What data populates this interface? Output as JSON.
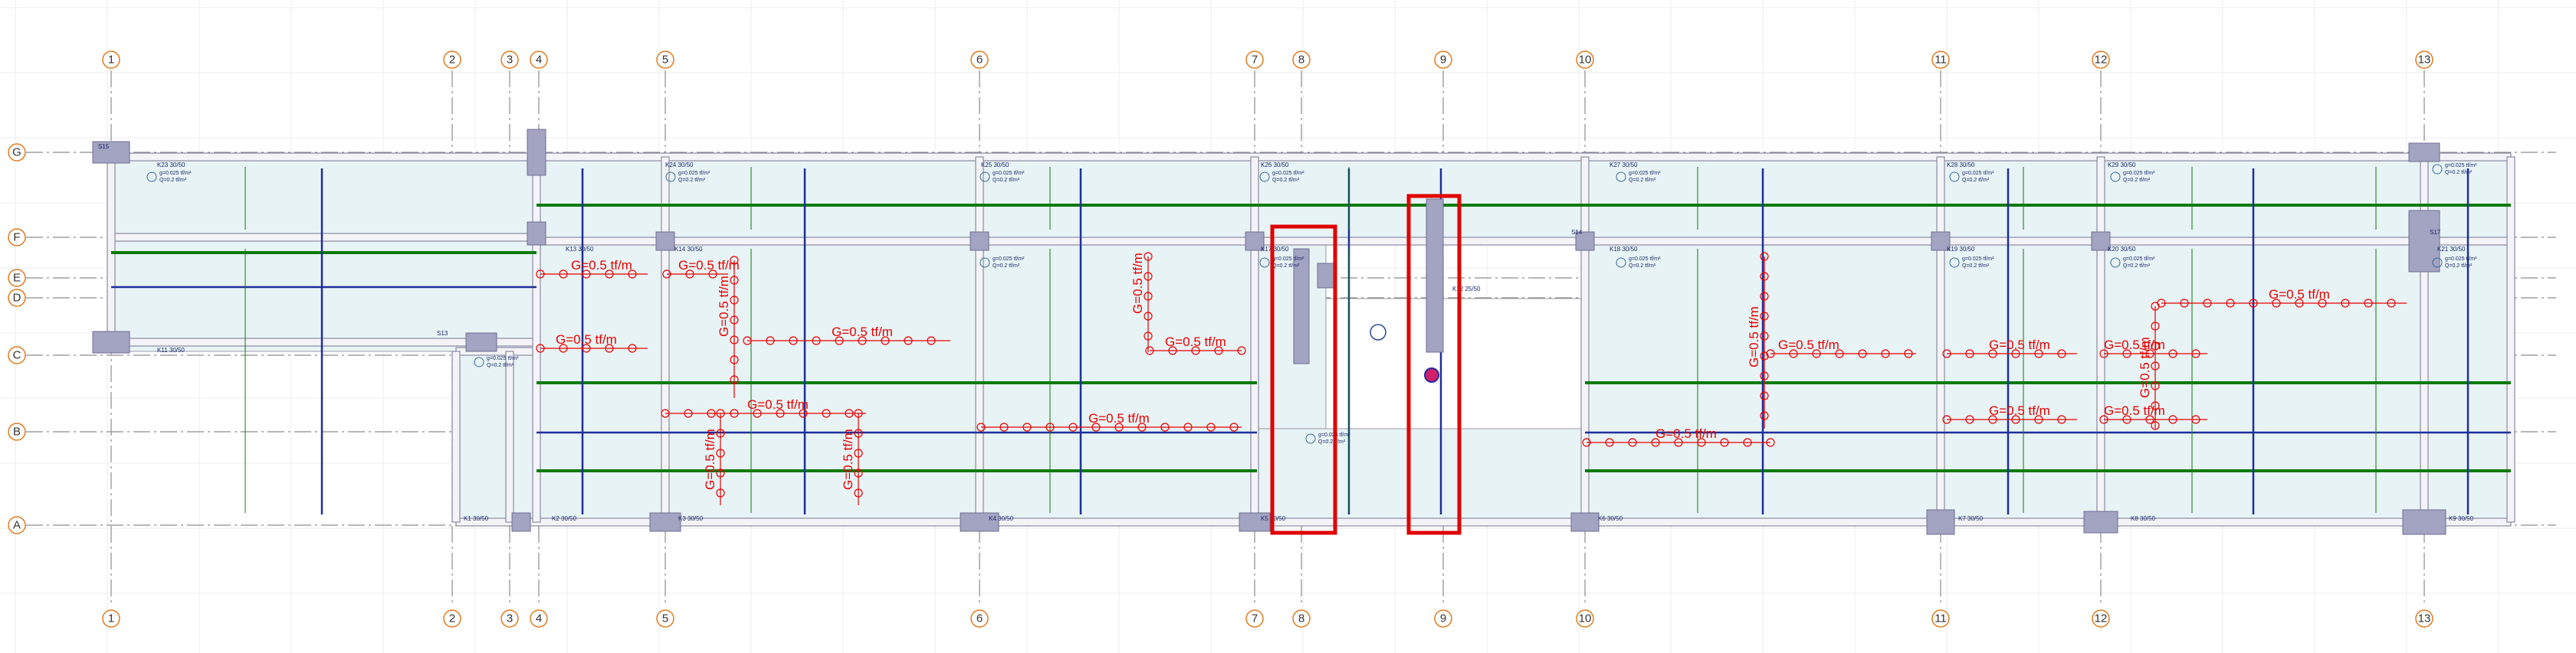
{
  "grid": {
    "columns": [
      {
        "label": "1"
      },
      {
        "label": "2"
      },
      {
        "label": "3"
      },
      {
        "label": "4"
      },
      {
        "label": "5"
      },
      {
        "label": "6"
      },
      {
        "label": "7"
      },
      {
        "label": "8"
      },
      {
        "label": "9"
      },
      {
        "label": "10"
      },
      {
        "label": "11"
      },
      {
        "label": "12"
      },
      {
        "label": "13"
      }
    ],
    "rows": [
      {
        "label": "G"
      },
      {
        "label": "F"
      },
      {
        "label": "E"
      },
      {
        "label": "D"
      },
      {
        "label": "C"
      },
      {
        "label": "B"
      },
      {
        "label": "A"
      }
    ]
  },
  "loads": {
    "value_h": "G=0.5 tf/m",
    "value_v": "G=0.5 tf/m"
  },
  "slab_note": {
    "line1": "g=0.025 tf/m²",
    "line2": "Q=0.2 tf/m²"
  },
  "beam_labels": {
    "k23": "K23  30/50",
    "k24": "K24  30/50",
    "k25": "K25  30/50",
    "k26": "K26  30/50",
    "k27": "K27  30/50",
    "k28": "K28  30/50",
    "k29": "K29  30/50",
    "k11": "K11  30/50",
    "k12": "K12  25/50",
    "k13": "K13  30/50",
    "k14": "K14  30/50",
    "k17": "K17  30/50",
    "k18": "K18  30/50",
    "k19": "K19  30/50",
    "k20": "K20  30/50",
    "k21": "K21  30/50",
    "k1": "K1  30/50",
    "k2": "K2  30/50",
    "k3": "K3  30/50",
    "k4": "K4  30/50",
    "k5": "K5  30/50",
    "k6": "K6  30/50",
    "k7": "K7  30/50",
    "k8": "K8  30/50",
    "k9": "K9  30/50",
    "s15": "S15",
    "s13": "S13",
    "s17": "S17",
    "s14": "S14"
  },
  "colors": {
    "grid_line": "#8c8c8c",
    "bubble": "#e07a1f",
    "slab_fill": "#e8f3f5",
    "column_fill": "#a3a3c2",
    "beam_blue": "#1f2f99",
    "beam_green": "#0e7a0e",
    "load_red": "#e60000",
    "highlight": "#e00000"
  }
}
